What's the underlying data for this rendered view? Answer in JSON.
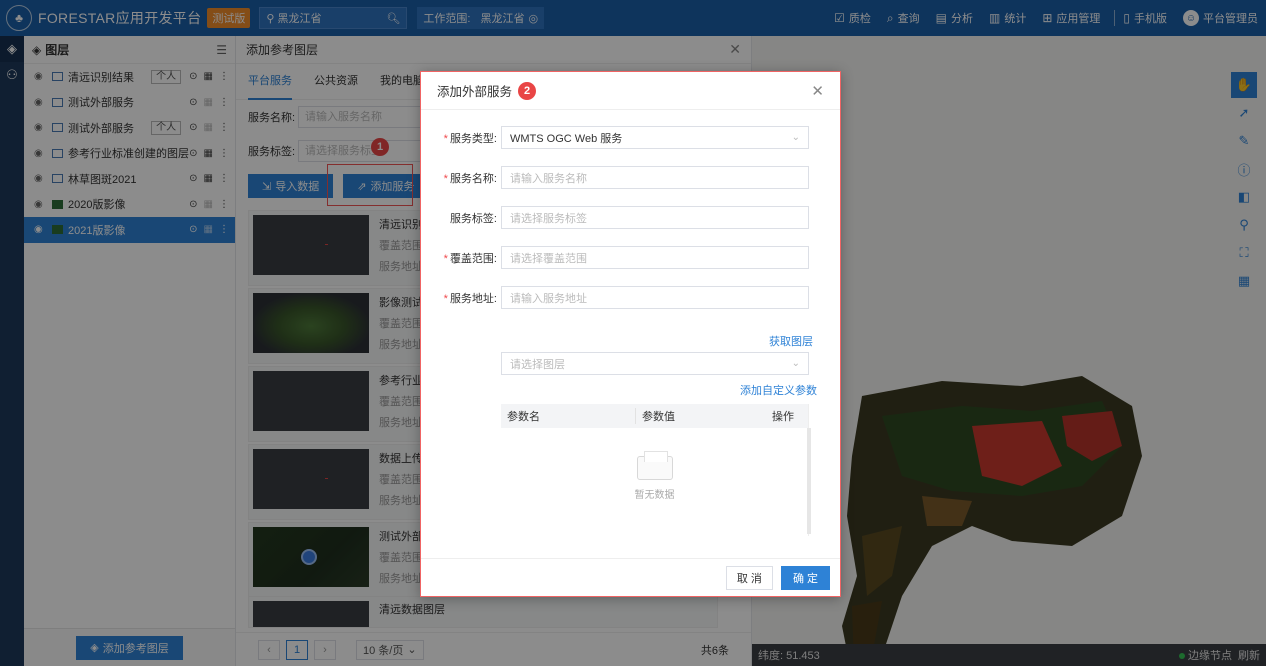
{
  "topbar": {
    "title": "FORESTAR应用开发平台",
    "badge": "测试版",
    "region": "黑龙江省",
    "scope_label": "工作范围:",
    "scope_value": "黑龙江省",
    "nav": [
      "质检",
      "查询",
      "分析",
      "统计",
      "应用管理"
    ],
    "mobile": "手机版",
    "user": "平台管理员"
  },
  "layers": {
    "title": "图层",
    "items": [
      {
        "name": "清远识别结果",
        "tag": "个人"
      },
      {
        "name": "测试外部服务",
        "tag": ""
      },
      {
        "name": "测试外部服务",
        "tag": "个人"
      },
      {
        "name": "参考行业标准创建的图层",
        "tag": ""
      },
      {
        "name": "林草图斑2021",
        "tag": ""
      },
      {
        "name": "2020版影像",
        "tag": ""
      },
      {
        "name": "2021版影像",
        "tag": ""
      }
    ],
    "add_button": "添加参考图层"
  },
  "ref_panel": {
    "title": "添加参考图层",
    "tabs": [
      "平台服务",
      "公共资源",
      "我的电脑"
    ],
    "name_label": "服务名称:",
    "name_placeholder": "请输入服务名称",
    "tag_label": "服务标签:",
    "tag_placeholder": "请选择服务标签",
    "import_button": "导入数据",
    "add_service_button": "添加服务",
    "step1": "1",
    "items": [
      {
        "name": "清远识别",
        "sub1": "覆盖范围",
        "sub2": "服务地址"
      },
      {
        "name": "影像测试",
        "sub1": "覆盖范围",
        "sub2": "服务地址"
      },
      {
        "name": "参考行业",
        "sub1": "覆盖范围",
        "sub2": "服务地址"
      },
      {
        "name": "数据上传",
        "sub1": "覆盖范围",
        "sub2": "服务地址"
      },
      {
        "name": "测试外部",
        "sub1": "覆盖范围",
        "sub2": "服务地址"
      }
    ],
    "last_item": "清远数据图层",
    "pager": {
      "page": "1",
      "size": "10 条/页",
      "total": "共6条"
    }
  },
  "map": {
    "latitude": "纬度: 51.453",
    "edge_node": "边缘节点",
    "refresh": "刷新"
  },
  "dialog": {
    "title": "添加外部服务",
    "step2": "2",
    "type_label": "服务类型:",
    "type_value": "WMTS OGC Web 服务",
    "name_label": "服务名称:",
    "name_placeholder": "请输入服务名称",
    "tag_label": "服务标签:",
    "tag_placeholder": "请选择服务标签",
    "range_label": "覆盖范围:",
    "range_placeholder": "请选择覆盖范围",
    "url_label": "服务地址:",
    "url_placeholder": "请输入服务地址",
    "fetch_layers": "获取图层",
    "layer_placeholder": "请选择图层",
    "add_param": "添加自定义参数",
    "columns": [
      "参数名",
      "参数值",
      "操作"
    ],
    "empty": "暂无数据",
    "cancel": "取 消",
    "ok": "确 定"
  }
}
